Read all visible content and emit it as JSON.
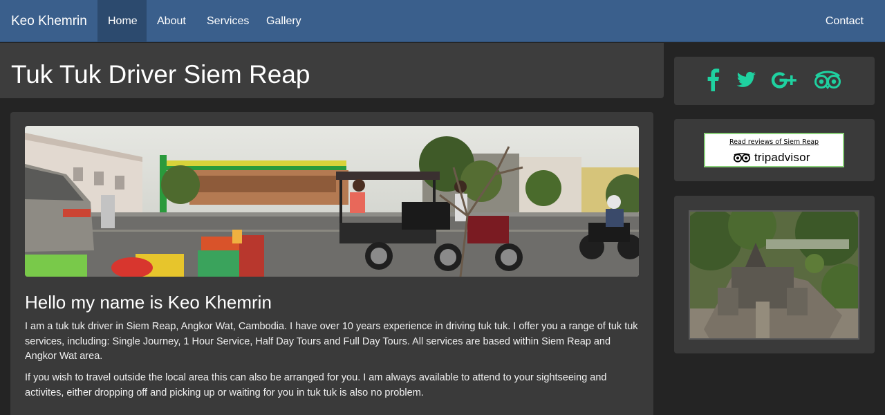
{
  "navbar": {
    "brand": "Keo Khemrin",
    "items": [
      {
        "label": "Home",
        "active": true
      },
      {
        "label": "About"
      },
      {
        "label": "Services"
      },
      {
        "label": "Gallery"
      }
    ],
    "contact": "Contact",
    "bg_color": "#3a5f8c"
  },
  "page": {
    "title": "Tuk Tuk Driver Siem Reap"
  },
  "main": {
    "heading": "Hello my name is Keo Khemrin",
    "paragraphs": [
      "I am a tuk tuk driver in Siem Reap, Angkor Wat, Cambodia. I have over 10 years experience in driving tuk tuk. I offer you a range of tuk tuk services, including: Single Journey, 1 Hour Service, Half Day Tours and Full Day Tours. All services are based within Siem Reap and Angkor Wat area.",
      "If you wish to travel outside the local area this can also be arranged for you. I am always available to attend to your sightseeing and activites, either dropping off and picking up or waiting for you in tuk tuk is also no problem."
    ]
  },
  "sidebar": {
    "social_icons": [
      "facebook-icon",
      "twitter-icon",
      "google-plus-icon",
      "tripadvisor-icon"
    ],
    "social_color": "#1fd1a0",
    "tripadvisor": {
      "link_text": "Read reviews of Siem Reap",
      "logo_text": "tripadvisor"
    }
  }
}
